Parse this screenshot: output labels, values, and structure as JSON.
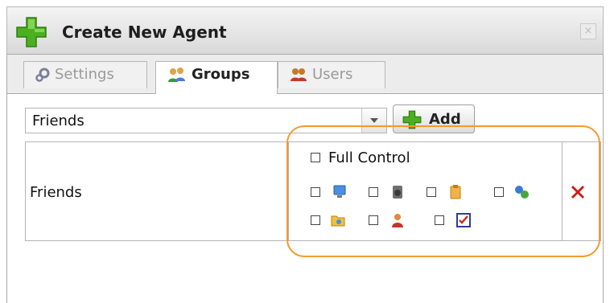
{
  "window": {
    "title": "Create New Agent",
    "title_icon": "green-plus-icon",
    "close_glyph": "×"
  },
  "tabs": [
    {
      "label": "Settings",
      "icon": "gear-icon",
      "active": false
    },
    {
      "label": "Groups",
      "icon": "groups-icon",
      "active": true
    },
    {
      "label": "Users",
      "icon": "users-icon",
      "active": false
    }
  ],
  "group_select": {
    "value": "Friends"
  },
  "add_button": {
    "label": "Add",
    "icon": "green-plus-icon"
  },
  "group_rows": [
    {
      "name": "Friends",
      "full_control_label": "Full Control",
      "permissions": [
        {
          "icon": "monitor-icon",
          "checked": false
        },
        {
          "icon": "speaker-icon",
          "checked": false
        },
        {
          "icon": "clipboard-icon",
          "checked": false
        },
        {
          "icon": "network-icon",
          "checked": false
        },
        {
          "icon": "folder-icon",
          "checked": false
        },
        {
          "icon": "user-icon",
          "checked": false
        },
        {
          "icon": "checklist-icon",
          "checked": false
        }
      ],
      "delete_icon": "red-x-icon"
    }
  ],
  "colors": {
    "highlight": "#f39a2e",
    "delete": "#cc1c12",
    "plus_green": "#4caf1f"
  }
}
